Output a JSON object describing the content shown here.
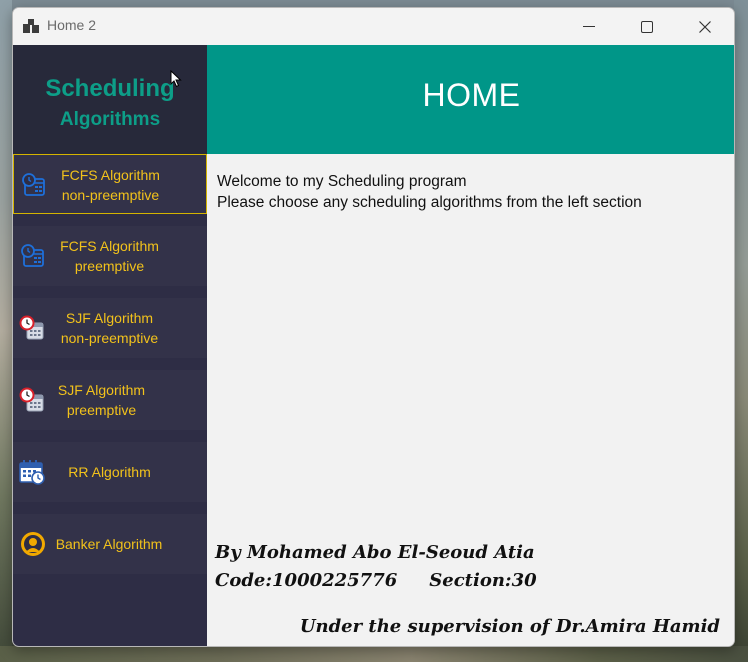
{
  "window": {
    "title": "Home 2"
  },
  "sidebar": {
    "logo_line1": "Scheduling",
    "logo_line2": "Algorithms",
    "items": [
      {
        "line1": "FCFS Algorithm",
        "line2": "non-preemptive",
        "icon": "calendar-clock-icon",
        "active": true
      },
      {
        "line1": "FCFS Algorithm",
        "line2": "preemptive",
        "icon": "calendar-clock-icon",
        "active": false
      },
      {
        "line1": "SJF Algorithm",
        "line2": "non-preemptive",
        "icon": "alarm-calendar-icon",
        "active": false
      },
      {
        "line1": "SJF Algorithm",
        "line2": "preemptive",
        "icon": "alarm-calendar-icon",
        "active": false
      },
      {
        "line1": "RR Algorithm",
        "line2": "",
        "icon": "calendar-timer-icon",
        "active": false
      },
      {
        "line1": "Banker Algorithm",
        "line2": "",
        "icon": "user-circle-icon",
        "active": false
      }
    ]
  },
  "header": {
    "title": "HOME"
  },
  "content": {
    "welcome_line1": "Welcome to my Scheduling program",
    "welcome_line2": "Please choose any scheduling algorithms from the left section",
    "author": "By Mohamed Abo El-Seoud Atia",
    "code": "Code:1000225776",
    "section": "Section:30",
    "supervision": "Under the supervision of Dr.Amira Hamid"
  },
  "colors": {
    "accent": "#009688",
    "sidebar_bg": "#2e2d45",
    "nav_text": "#f2c21b",
    "logo_text": "#0d9e88",
    "active_border": "#d4b400"
  }
}
